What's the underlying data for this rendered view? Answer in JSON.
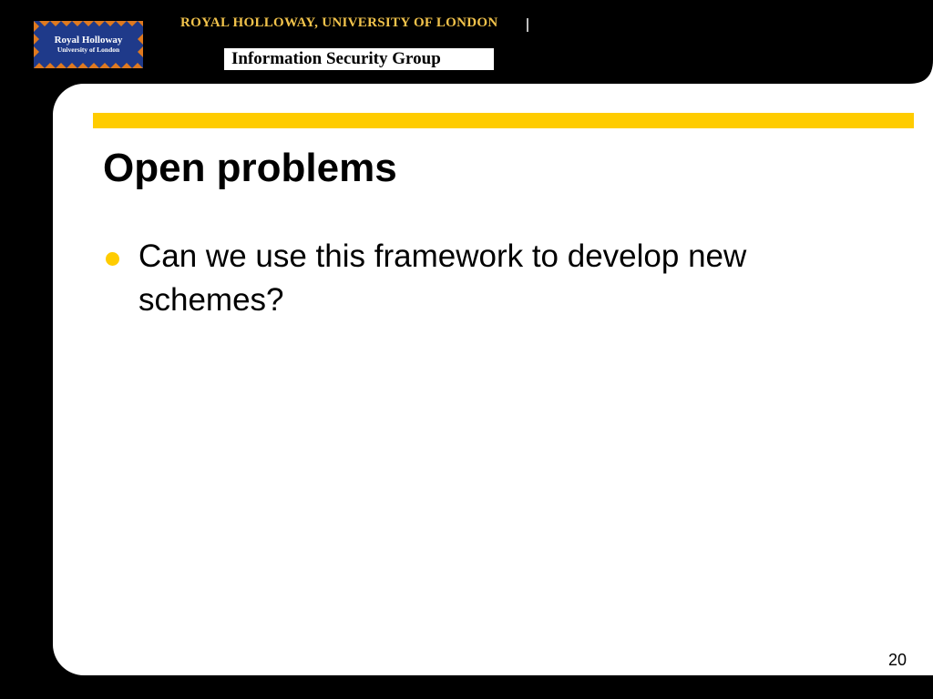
{
  "header": {
    "logo": {
      "line1": "Royal Holloway",
      "line2": "University of London"
    },
    "institution": "ROYAL HOLLOWAY, UNIVERSITY OF LONDON",
    "group": "Information Security Group"
  },
  "slide": {
    "title": "Open problems",
    "bullets": [
      "Can we use this framework to develop new schemes?"
    ],
    "page_number": "20"
  },
  "colors": {
    "background": "#000000",
    "panel": "#ffffff",
    "accent": "#ffcc00",
    "institution_text": "#f2c34b",
    "logo_blue": "#1f3a8a",
    "logo_orange": "#e07a1f"
  },
  "icons": {
    "bullet": "yellow-circle-bullet-icon",
    "logo": "royal-holloway-crest-logo"
  }
}
